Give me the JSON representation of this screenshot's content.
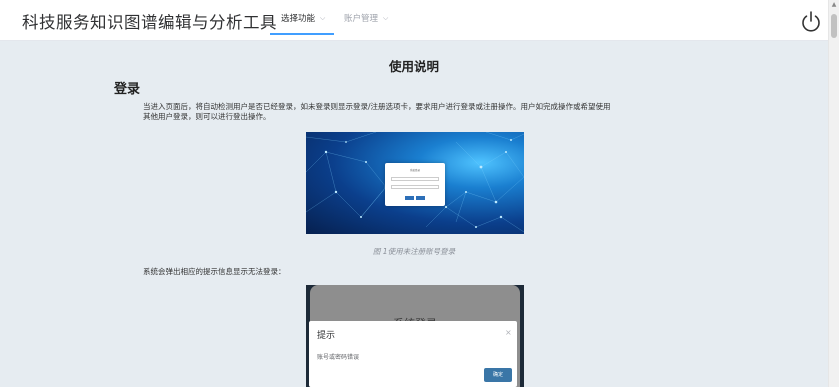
{
  "header": {
    "app_title": "科技服务知识图谱编辑与分析工具",
    "nav": [
      {
        "label": "选择功能",
        "active": true
      },
      {
        "label": "账户管理",
        "active": false
      }
    ],
    "power_icon": "power-icon"
  },
  "doc": {
    "title": "使用说明",
    "section_heading": "登录",
    "paragraph1_line1": "当进入页面后，将自动检测用户是否已经登录，如未登录则显示登录/注册选项卡，要求用户进行登录或注册操作。用户如完成操作或希望使用",
    "paragraph1_line2": "其他用户登录，则可以进行登出操作。",
    "figure1_caption": "图 1使用未注册账号登录",
    "figure1_login": {
      "title": "系统登录",
      "login_button": "登录",
      "register_button": "注册"
    },
    "paragraph2": "系统会弹出相应的提示信息显示无法登录：",
    "figure2": {
      "background_title": "系统登录",
      "dialog_title": "提示",
      "dialog_close": "×",
      "dialog_message": "账号或密码错误",
      "dialog_ok": "确定"
    }
  },
  "colors": {
    "accent": "#409eff",
    "page_bg": "#e6ecf1",
    "dialog_button": "#3a76a7"
  }
}
